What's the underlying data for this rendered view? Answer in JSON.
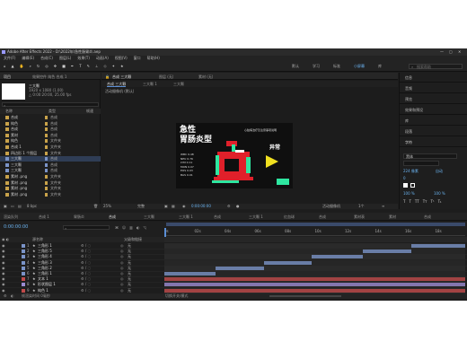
{
  "titlebar": {
    "text": "Adobe After Effects 2022 - D:\\2022年\\急性肠胃炎.aep"
  },
  "menus": [
    "文件(F)",
    "编辑(E)",
    "合成(C)",
    "图层(L)",
    "效果(T)",
    "动画(A)",
    "视图(V)",
    "窗口",
    "帮助(H)"
  ],
  "workspaces": [
    "默认",
    "学习",
    "标准",
    "小屏幕",
    "库"
  ],
  "toolbar": {
    "search_placeholder": "搜索帮助"
  },
  "project": {
    "tab": "项目",
    "effects_tab": "效果控件 纯色 合成 1",
    "selected_name": "三大颗",
    "selected_info": "1920 x 1080 (1.00)",
    "selected_duration": "△ 0:00:20:00, 25.00 fps",
    "columns": {
      "name": "名称",
      "type": "类型",
      "size": "帧速"
    },
    "items": [
      {
        "name": "合成",
        "type": "合成",
        "color": "#c8a24a"
      },
      {
        "name": "纯色",
        "type": "合成",
        "color": "#c8a24a"
      },
      {
        "name": "合成",
        "type": "合成",
        "color": "#c8a24a"
      },
      {
        "name": "素材",
        "type": "合成",
        "color": "#c8a24a"
      },
      {
        "name": "纯色",
        "type": "文件夹",
        "color": "#c8a24a"
      },
      {
        "name": "合成 1",
        "type": "文件夹",
        "color": "#c8a24a"
      },
      {
        "name": "四边形 1 个图层",
        "type": "文件夹",
        "color": "#c8a24a"
      },
      {
        "name": "三大颗",
        "type": "合成",
        "color": "#7a93c7"
      },
      {
        "name": "三大颗",
        "type": "合成",
        "color": "#7a93c7"
      },
      {
        "name": "三大颗",
        "type": "合成",
        "color": "#7a93c7"
      },
      {
        "name": "素材 .png",
        "type": "文件夹",
        "color": "#c8a24a"
      },
      {
        "name": "素材 .png",
        "type": "文件夹",
        "color": "#c8a24a"
      },
      {
        "name": "素材 .png",
        "type": "文件夹",
        "color": "#c8a24a"
      },
      {
        "name": "素材 .png",
        "type": "文件夹",
        "color": "#c8a24a"
      }
    ],
    "footer_bpc": "8 bpc"
  },
  "viewer": {
    "tabs": [
      "合成 三大颗",
      "图层 (无)",
      "素材 (无)"
    ],
    "subtabs": [
      "合成 三大颗",
      "三大颗 1",
      "三大颗"
    ],
    "breadcrumb": "活动摄像机 (默认)",
    "card": {
      "title_line1": "急性",
      "title_line2": "胃肠炎型",
      "side_label": "异常",
      "stats": [
        "WBC 9.48",
        "NEU 0.76",
        "LYM 0.11",
        "MON 0.07",
        "EOS 0.03",
        "BAS 0.01"
      ],
      "caption": "心脏病治疗及注意事项说明"
    },
    "zoom": "25%",
    "quality": "完整",
    "timecode": "0:00:00:00",
    "camera": "活动摄像机",
    "view_count": "1个"
  },
  "right_panel": {
    "sections": [
      "信息",
      "音频",
      "预览",
      "效果和预设",
      "库",
      "段落",
      "字符"
    ],
    "font": "黑体",
    "font_size": "224 像素",
    "tracking": "0",
    "scale_h": "100 %",
    "scale_v": "100 %"
  },
  "timeline": {
    "tabs": [
      "渲染队列",
      "合成 1",
      "胃肠炎",
      "合成",
      "三大颗",
      "三大颗 1",
      "合成",
      "三大颗 1",
      "红血球",
      "合成",
      "素材表",
      "素材",
      "合成"
    ],
    "timecode": "0:00:00:00",
    "col_source": "源名称",
    "col_parent": "父级和链接",
    "ruler": [
      "0s",
      "02s",
      "04s",
      "06s",
      "08s",
      "10s",
      "12s",
      "14s",
      "16s",
      "18s",
      "20s"
    ],
    "layers": [
      {
        "num": "1",
        "name": "三角形 1",
        "parent": "无",
        "color": "#7a93c7",
        "start": 0.82,
        "end": 1.0
      },
      {
        "num": "2",
        "name": "三角形 5",
        "parent": "无",
        "color": "#7a93c7",
        "start": 0.66,
        "end": 0.82
      },
      {
        "num": "3",
        "name": "三角形 4",
        "parent": "无",
        "color": "#7a93c7",
        "start": 0.49,
        "end": 0.66
      },
      {
        "num": "4",
        "name": "三角形 3",
        "parent": "无",
        "color": "#7a93c7",
        "start": 0.33,
        "end": 0.49
      },
      {
        "num": "5",
        "name": "三角形 2",
        "parent": "无",
        "color": "#7a93c7",
        "start": 0.17,
        "end": 0.33
      },
      {
        "num": "6",
        "name": "三角形 1",
        "parent": "无",
        "color": "#7a93c7",
        "start": 0.0,
        "end": 0.17
      },
      {
        "num": "7",
        "name": "文本 1",
        "parent": "无",
        "color": "#c04a4a",
        "start": 0.0,
        "end": 1.0
      },
      {
        "num": "8",
        "name": "形状图层 1",
        "parent": "无",
        "color": "#9b8bd1",
        "start": 0.0,
        "end": 1.0
      },
      {
        "num": "9",
        "name": "纯色 1",
        "parent": "无",
        "color": "#c04a4a",
        "start": 0.0,
        "end": 1.0
      }
    ],
    "footer": "帧渲染时间 0毫秒"
  }
}
